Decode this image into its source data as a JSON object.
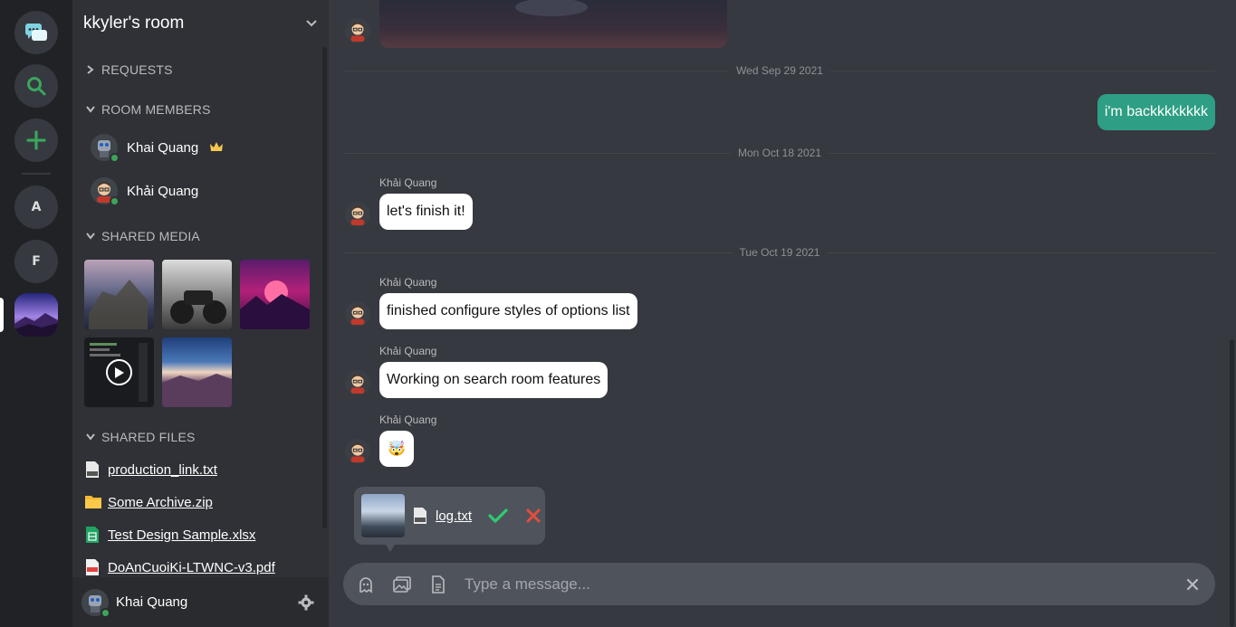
{
  "rail": {
    "spaces": [
      "A",
      "F"
    ]
  },
  "sidebar": {
    "room_title": "kkyler's room",
    "sections": {
      "requests": "REQUESTS",
      "members": "ROOM MEMBERS",
      "media": "SHARED MEDIA",
      "files": "SHARED FILES"
    },
    "members": [
      {
        "name": "Khai Quang",
        "owner": true
      },
      {
        "name": "Khải Quang",
        "owner": false
      }
    ],
    "files": [
      {
        "name": "production_link.txt",
        "icon": "text-file-icon"
      },
      {
        "name": "Some Archive.zip",
        "icon": "folder-icon"
      },
      {
        "name": "Test Design Sample.xlsx",
        "icon": "spreadsheet-icon"
      },
      {
        "name": "DoAnCuoiKi-LTWNC-v3.pdf",
        "icon": "pdf-icon"
      }
    ],
    "user": {
      "name": "Khai Quang"
    }
  },
  "chat": {
    "dates": [
      "Wed Sep 29 2021",
      "Mon Oct 18 2021",
      "Tue Oct 19 2021"
    ],
    "own_message": "i'm backkkkkkkk",
    "messages": [
      {
        "author": "Khải Quang",
        "text": "let's finish it!"
      },
      {
        "author": "Khải Quang",
        "text": "finished configure styles of options list"
      },
      {
        "author": "Khải Quang",
        "text": "Working on search room features"
      },
      {
        "author": "Khải Quang",
        "text": "🤯"
      }
    ],
    "upload": {
      "file_name": "log.txt"
    },
    "composer": {
      "placeholder": "Type a message..."
    }
  },
  "colors": {
    "accent": "#2e9e84",
    "online": "#3ba55c",
    "confirm": "#2ecc71",
    "cancel": "#e74c3c"
  }
}
